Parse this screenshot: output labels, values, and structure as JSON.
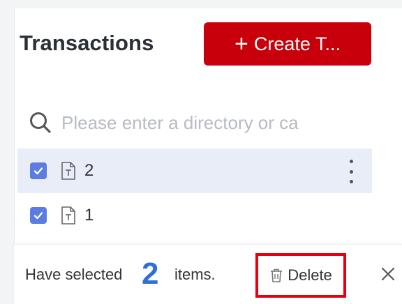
{
  "header": {
    "title": "Transactions",
    "create_button_label": "Create T..."
  },
  "search": {
    "placeholder": "Please enter a directory or ca",
    "value": ""
  },
  "list": {
    "items": [
      {
        "label": "2",
        "selected": true,
        "checked": true
      },
      {
        "label": "1",
        "selected": false,
        "checked": true
      }
    ]
  },
  "selection_bar": {
    "prefix": "Have selected",
    "count": "2",
    "suffix": "items.",
    "delete_label": "Delete"
  },
  "icons": {
    "create": "plus-icon",
    "search": "search-icon",
    "file": "text-file-icon",
    "more": "more-vertical-icon",
    "delete": "trash-icon",
    "close": "close-icon",
    "check": "check-icon"
  },
  "colors": {
    "brand_red": "#c7000b",
    "checkbox_blue": "#5b7ce0",
    "selected_row_bg": "#e8edf8",
    "count_blue": "#2f6fd6",
    "highlight_border": "#e6000f"
  }
}
